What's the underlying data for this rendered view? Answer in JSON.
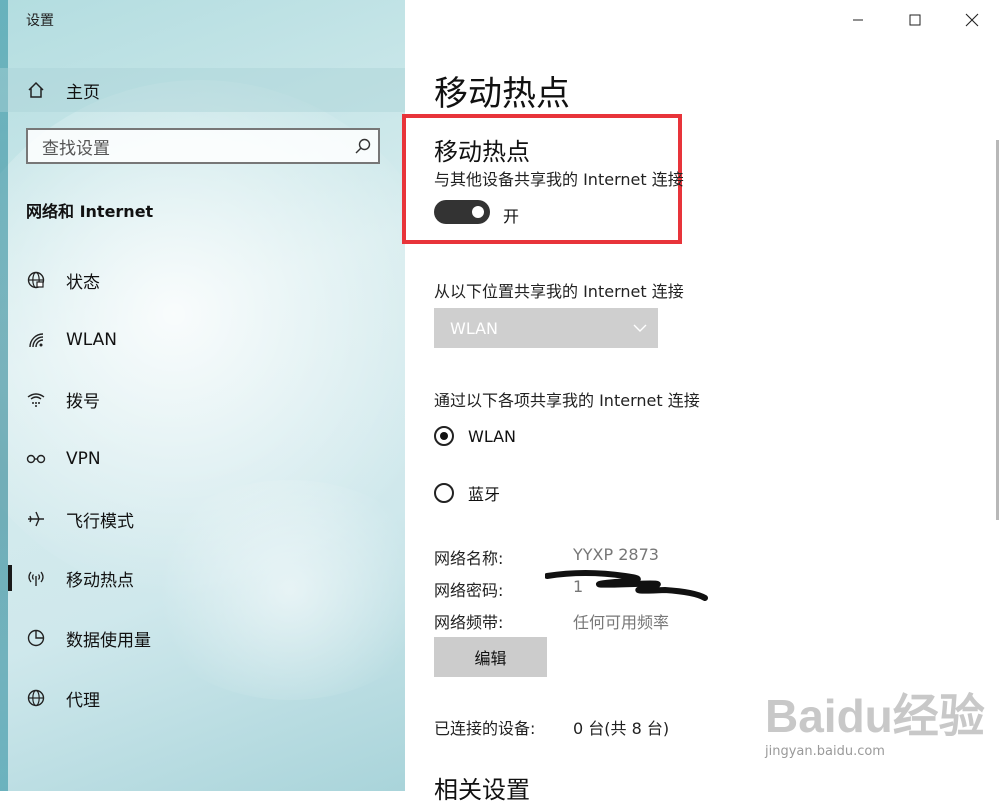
{
  "window": {
    "title": "设置"
  },
  "sidebar": {
    "home_label": "主页",
    "search_placeholder": "查找设置",
    "section_title": "网络和 Internet",
    "items": [
      {
        "label": "状态",
        "icon": "globe-status-icon"
      },
      {
        "label": "WLAN",
        "icon": "wifi-icon"
      },
      {
        "label": "拨号",
        "icon": "dialup-icon"
      },
      {
        "label": "VPN",
        "icon": "vpn-icon"
      },
      {
        "label": "飞行模式",
        "icon": "airplane-icon"
      },
      {
        "label": "移动热点",
        "icon": "hotspot-icon",
        "active": true
      },
      {
        "label": "数据使用量",
        "icon": "pie-chart-icon"
      },
      {
        "label": "代理",
        "icon": "globe-icon"
      }
    ]
  },
  "main": {
    "page_title": "移动热点",
    "hotspot": {
      "title": "移动热点",
      "description": "与其他设备共享我的 Internet 连接",
      "toggle_state": "开"
    },
    "share_from": {
      "label": "从以下位置共享我的 Internet 连接",
      "selected": "WLAN"
    },
    "share_via": {
      "label": "通过以下各项共享我的 Internet 连接",
      "options": [
        {
          "label": "WLAN",
          "selected": true
        },
        {
          "label": "蓝牙",
          "selected": false
        }
      ]
    },
    "network_info": {
      "name_key": "网络名称:",
      "name_value": "YYXP 2873",
      "password_key": "网络密码:",
      "password_value": "1",
      "band_key": "网络频带:",
      "band_value": "任何可用频率"
    },
    "edit_label": "编辑",
    "connected": {
      "key": "已连接的设备:",
      "value": "0 台(共 8 台)"
    },
    "related_title": "相关设置"
  },
  "watermark": {
    "brand": "Baidu经验",
    "url": "jingyan.baidu.com"
  },
  "colors": {
    "highlight_box": "#e8343a",
    "toggle_on": "#333333",
    "dropdown_bg": "#cfcfcf"
  }
}
